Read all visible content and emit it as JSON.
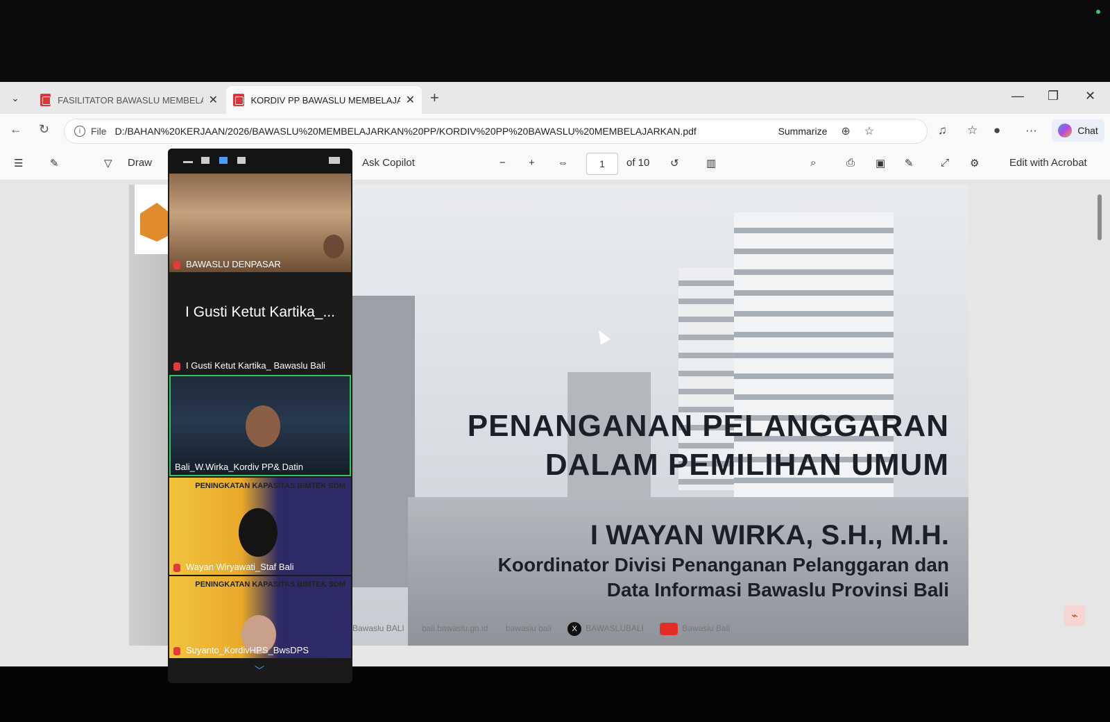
{
  "browser": {
    "tabs": [
      {
        "title": "FASILITATOR BAWASLU MEMBELAJ",
        "active": false
      },
      {
        "title": "KORDIV PP BAWASLU MEMBELAJA",
        "active": true
      }
    ],
    "file_label": "File",
    "url": "D:/BAHAN%20KERJAAN/2026/BAWASLU%20MEMBELAJARKAN%20PP/KORDIV%20PP%20BAWASLU%20MEMBELAJARKAN.pdf",
    "summarize": "Summarize",
    "chat": "Chat"
  },
  "pdf_toolbar": {
    "draw": "Draw",
    "ask_copilot": "Ask Copilot",
    "page": "1",
    "of_pages": "of 10",
    "edit_acrobat": "Edit with Acrobat"
  },
  "slide": {
    "title_line1": "PENANGANAN PELANGGARAN",
    "title_line2": "DALAM PEMILIHAN UMUM",
    "presenter": "I WAYAN WIRKA, S.H., M.H.",
    "role_line1": "Koordinator Divisi Penanganan Pelanggaran dan",
    "role_line2": "Data Informasi Bawaslu Provinsi Bali",
    "social": [
      "Bawaslu BALI",
      "bali.bawaslu.go.id",
      "bawaslu bali",
      "BAWASLUBALI",
      "Bawaslu Bali"
    ]
  },
  "zoom": {
    "participants": [
      {
        "name": "BAWASLU DENPASAR",
        "muted": true
      },
      {
        "display": "I Gusti Ketut Kartika_...",
        "name": "I Gusti Ketut Kartika_ Bawaslu Bali",
        "muted": true
      },
      {
        "name": "Bali_W.Wirka_Kordiv PP& Datin",
        "speaking": true
      },
      {
        "name": "Wayan Wiryawati_Staf Bali",
        "muted": true
      },
      {
        "name": "Suyanto_KordivHPS_BwsDPS",
        "muted": true
      }
    ],
    "banner_text": "PENINGKATAN KAPASITAS BIMTEK SDM"
  },
  "colors": {
    "accent_green": "#34c759",
    "pdf_red": "#d9373c"
  }
}
